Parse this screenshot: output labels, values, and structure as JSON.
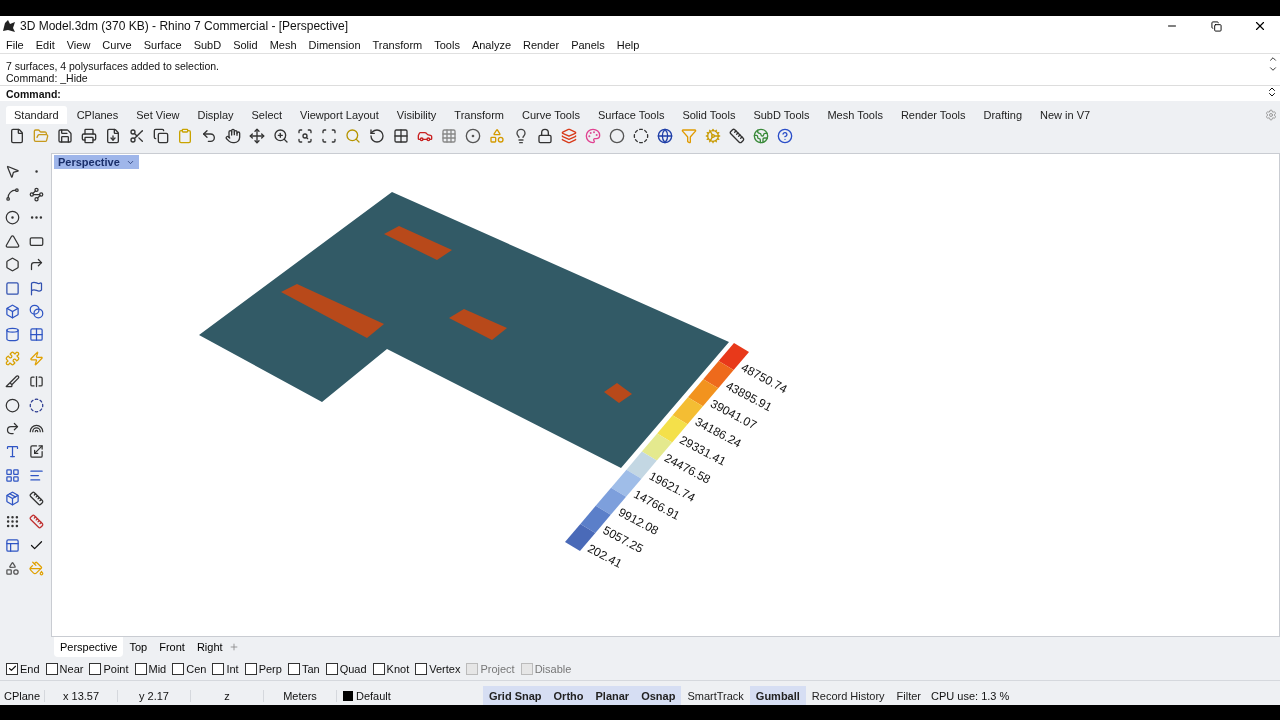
{
  "window": {
    "title": "3D Model.3dm (370 KB) - Rhino 7 Commercial - [Perspective]"
  },
  "menu": [
    "File",
    "Edit",
    "View",
    "Curve",
    "Surface",
    "SubD",
    "Solid",
    "Mesh",
    "Dimension",
    "Transform",
    "Tools",
    "Analyze",
    "Render",
    "Panels",
    "Help"
  ],
  "command_history": [
    "7 surfaces, 4 polysurfaces added to selection.",
    "Command: _Hide"
  ],
  "command_prompt": "Command:",
  "toolbar_tabs": [
    {
      "label": "Standard",
      "selected": true
    },
    {
      "label": "CPlanes",
      "selected": false
    },
    {
      "label": "Set View",
      "selected": false
    },
    {
      "label": "Display",
      "selected": false
    },
    {
      "label": "Select",
      "selected": false
    },
    {
      "label": "Viewport Layout",
      "selected": false
    },
    {
      "label": "Visibility",
      "selected": false
    },
    {
      "label": "Transform",
      "selected": false
    },
    {
      "label": "Curve Tools",
      "selected": false
    },
    {
      "label": "Surface Tools",
      "selected": false
    },
    {
      "label": "Solid Tools",
      "selected": false
    },
    {
      "label": "SubD Tools",
      "selected": false
    },
    {
      "label": "Mesh Tools",
      "selected": false
    },
    {
      "label": "Render Tools",
      "selected": false
    },
    {
      "label": "Drafting",
      "selected": false
    },
    {
      "label": "New in V7",
      "selected": false
    }
  ],
  "viewport": {
    "title": "Perspective",
    "legend": [
      {
        "label": "48750.74",
        "color": "#e8391a"
      },
      {
        "label": "43895.91",
        "color": "#ee6a1c"
      },
      {
        "label": "39041.07",
        "color": "#f2931e"
      },
      {
        "label": "34186.24",
        "color": "#f4bd33"
      },
      {
        "label": "29331.41",
        "color": "#f4e04a"
      },
      {
        "label": "24476.58",
        "color": "#e4e98e"
      },
      {
        "label": "19621.74",
        "color": "#c3d7e3"
      },
      {
        "label": "14766.91",
        "color": "#9fbde8"
      },
      {
        "label": "9912.08",
        "color": "#7d9fdc"
      },
      {
        "label": "5057.25",
        "color": "#5b7fc9"
      },
      {
        "label": "202.41",
        "color": "#4a6ab8"
      }
    ]
  },
  "viewport_tabs": [
    {
      "label": "Perspective",
      "selected": true
    },
    {
      "label": "Top",
      "selected": false
    },
    {
      "label": "Front",
      "selected": false
    },
    {
      "label": "Right",
      "selected": false
    }
  ],
  "osnaps": [
    {
      "label": "End",
      "checked": true,
      "disabled": false
    },
    {
      "label": "Near",
      "checked": false,
      "disabled": false
    },
    {
      "label": "Point",
      "checked": false,
      "disabled": false
    },
    {
      "label": "Mid",
      "checked": false,
      "disabled": false
    },
    {
      "label": "Cen",
      "checked": false,
      "disabled": false
    },
    {
      "label": "Int",
      "checked": false,
      "disabled": false
    },
    {
      "label": "Perp",
      "checked": false,
      "disabled": false
    },
    {
      "label": "Tan",
      "checked": false,
      "disabled": false
    },
    {
      "label": "Quad",
      "checked": false,
      "disabled": false
    },
    {
      "label": "Knot",
      "checked": false,
      "disabled": false
    },
    {
      "label": "Vertex",
      "checked": false,
      "disabled": false
    },
    {
      "label": "Project",
      "checked": false,
      "disabled": true
    },
    {
      "label": "Disable",
      "checked": false,
      "disabled": true
    }
  ],
  "status_bar": {
    "cplane": "CPlane",
    "x": "x 13.57",
    "y": "y 2.17",
    "z": "z",
    "units": "Meters",
    "layer": {
      "label": "Default",
      "color": "#000000"
    },
    "toggles": [
      {
        "label": "Grid Snap",
        "on": true
      },
      {
        "label": "Ortho",
        "on": true
      },
      {
        "label": "Planar",
        "on": true
      },
      {
        "label": "Osnap",
        "on": true
      },
      {
        "label": "SmartTrack",
        "on": false
      },
      {
        "label": "Gumball",
        "on": true
      },
      {
        "label": "Record History",
        "on": false
      },
      {
        "label": "Filter",
        "on": false
      }
    ],
    "cpu": "CPU use: 1.3 %"
  }
}
